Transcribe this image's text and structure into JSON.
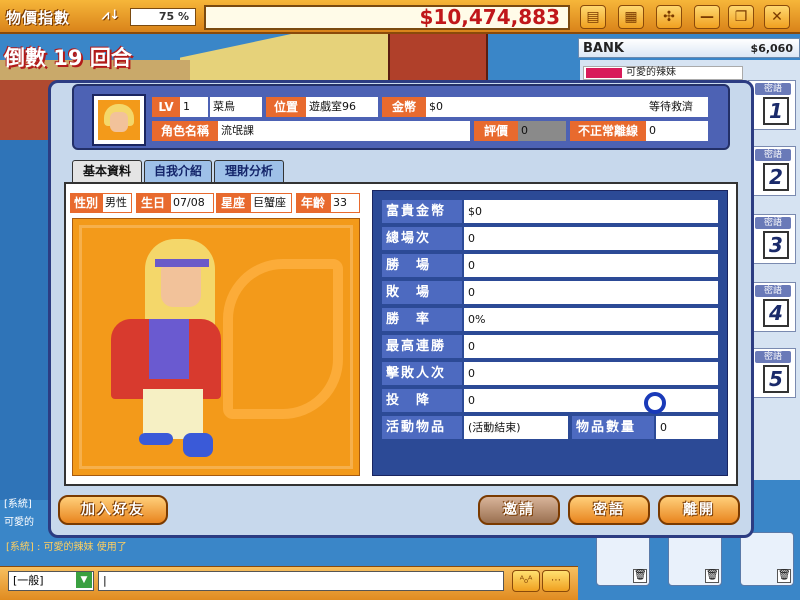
{
  "topbar": {
    "price_index_label": "物價指數",
    "price_index_value": "75 %",
    "money": "$10,474,883",
    "buttons": [
      "note-icon",
      "grid-icon",
      "move-icon",
      "minimize-icon",
      "restore-icon",
      "close-icon"
    ]
  },
  "countdown": "倒數 19 回合",
  "bank": {
    "label": "BANK",
    "value": "$6,060"
  },
  "players": [
    {
      "name": "可愛的辣妹",
      "whisper": "密語",
      "number": "1"
    },
    {
      "whisper": "密語",
      "number": "2"
    },
    {
      "whisper": "密語",
      "number": "3"
    },
    {
      "whisper": "密語",
      "number": "4"
    },
    {
      "whisper": "密語",
      "number": "5"
    }
  ],
  "profile": {
    "lv_label": "LV",
    "lv": "1",
    "rank": "菜鳥",
    "location_label": "位置",
    "location": "遊戲室96",
    "gold_label": "金幣",
    "gold": "$0",
    "status": "等待救濟",
    "name_label": "角色名稱",
    "name": "流氓課",
    "rating_label": "評價",
    "rating": "0",
    "abnormal_label": "不正常離線",
    "abnormal": "0"
  },
  "tabs": [
    "基本資料",
    "自我介紹",
    "理財分析"
  ],
  "basic": {
    "gender_label": "性別",
    "gender": "男性",
    "birthday_label": "生日",
    "birthday": "07/08",
    "sign_label": "星座",
    "sign": "巨蟹座",
    "age_label": "年齡",
    "age": "33"
  },
  "stats": [
    {
      "label": "富貴金幣",
      "value": "$0"
    },
    {
      "label": "總場次",
      "value": "0"
    },
    {
      "label": "勝　場",
      "value": "0"
    },
    {
      "label": "敗　場",
      "value": "0"
    },
    {
      "label": "勝　率",
      "value": "0%"
    },
    {
      "label": "最高連勝",
      "value": "0"
    },
    {
      "label": "擊敗人次",
      "value": "0"
    },
    {
      "label": "投　降",
      "value": "0"
    }
  ],
  "activity": {
    "label": "活動物品",
    "value": "(活動結束)",
    "count_label": "物品數量",
    "count": "0"
  },
  "buttons": {
    "add_friend": "加入好友",
    "invite": "邀請",
    "whisper": "密語",
    "leave": "離開"
  },
  "chat": {
    "lines": [
      "[系統]",
      "可愛的",
      ""
    ],
    "log": "[系統] : 可愛的辣妹 使用了 "
  },
  "input": {
    "channel": "[一般]",
    "value": "|"
  },
  "colors": {
    "accent": "#e86a2e",
    "dialog_border": "#2c3c82",
    "money": "#c0171a"
  }
}
